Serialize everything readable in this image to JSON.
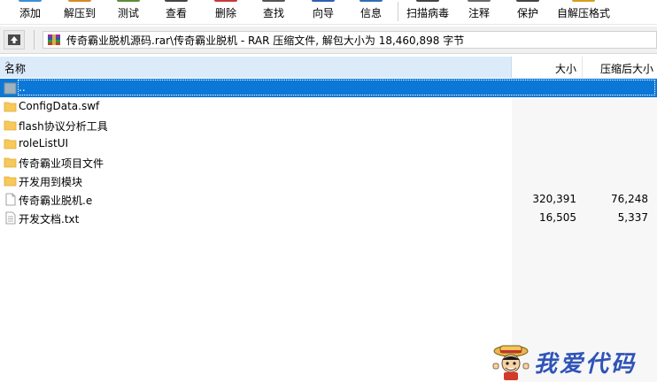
{
  "toolbar": {
    "buttons": [
      {
        "label": "添加",
        "icon": "add-icon",
        "color": "#3a8fd8"
      },
      {
        "label": "解压到",
        "icon": "extract-to-icon",
        "color": "#d48a24"
      },
      {
        "label": "测试",
        "icon": "test-icon",
        "color": "#5b8c3a"
      },
      {
        "label": "查看",
        "icon": "view-icon",
        "color": "#444444"
      },
      {
        "label": "删除",
        "icon": "delete-icon",
        "color": "#c73a3a"
      },
      {
        "label": "查找",
        "icon": "find-icon",
        "color": "#555555"
      },
      {
        "label": "向导",
        "icon": "wizard-icon",
        "color": "#2f5fb3"
      },
      {
        "label": "信息",
        "icon": "info-icon",
        "color": "#2f6fb3"
      },
      {
        "label": "扫描病毒",
        "icon": "scan-virus-icon",
        "color": "#444444"
      },
      {
        "label": "注释",
        "icon": "comment-icon",
        "color": "#6a6a6a"
      },
      {
        "label": "保护",
        "icon": "protect-icon",
        "color": "#444444"
      },
      {
        "label": "自解压格式",
        "icon": "sfx-icon",
        "color": "#d4a020"
      }
    ]
  },
  "address": {
    "path": "传奇霸业脱机源码.rar\\传奇霸业脱机 - RAR 压缩文件, 解包大小为 18,460,898 字节"
  },
  "columns": {
    "name": "名称",
    "size": "大小",
    "packed": "压缩后大小"
  },
  "files": [
    {
      "name": "..",
      "type": "parent",
      "size": "",
      "packed": ""
    },
    {
      "name": "ConfigData.swf",
      "type": "folder",
      "size": "",
      "packed": ""
    },
    {
      "name": "flash协议分析工具",
      "type": "folder",
      "size": "",
      "packed": ""
    },
    {
      "name": "roleListUI",
      "type": "folder",
      "size": "",
      "packed": ""
    },
    {
      "name": "传奇霸业项目文件",
      "type": "folder",
      "size": "",
      "packed": ""
    },
    {
      "name": "开发用到模块",
      "type": "folder",
      "size": "",
      "packed": ""
    },
    {
      "name": "传奇霸业脱机.e",
      "type": "file",
      "size": "320,391",
      "packed": "76,248"
    },
    {
      "name": "开发文档.txt",
      "type": "text",
      "size": "16,505",
      "packed": "5,337"
    }
  ],
  "watermark": {
    "text": "我爱代码"
  },
  "colors": {
    "selection": "#0b78d7",
    "header_active": "#dcebfa",
    "folder": "#f7c85a"
  }
}
